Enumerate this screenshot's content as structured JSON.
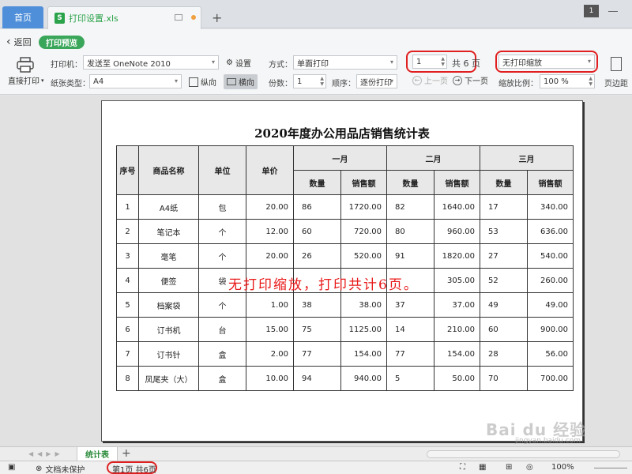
{
  "tabs": {
    "home": "首页",
    "file_name": "打印设置.xls",
    "file_icon_letter": "S",
    "add": "+",
    "window_count": "1"
  },
  "toolbar": {
    "back": "返回",
    "preview_badge": "打印预览",
    "direct_print": "直接打印",
    "printer_label": "打印机：",
    "printer_value": "发送至 OneNote 2010",
    "settings": "设置",
    "paper_label": "纸张类型：",
    "paper_value": "A4",
    "portrait": "纵向",
    "landscape": "横向",
    "mode_label": "方式：",
    "mode_value": "单面打印",
    "copies_label": "份数：",
    "copies_value": "1",
    "order_label": "顺序：",
    "order_value": "逐份打印",
    "page_current": "1",
    "page_total": "共 6 页",
    "prev_page": "上一页",
    "next_page": "下一页",
    "scale_value": "无打印缩放",
    "zoom_label": "缩放比例：",
    "zoom_value": "100 %",
    "page_margin": "页边距"
  },
  "document": {
    "title": "2020年度办公用品店销售统计表",
    "headers": {
      "seq": "序号",
      "product": "商品名称",
      "unit": "单位",
      "price": "单价",
      "jan": "一月",
      "feb": "二月",
      "mar": "三月",
      "qty": "数量",
      "sales": "销售额"
    },
    "rows": [
      {
        "seq": "1",
        "product": "A4纸",
        "unit": "包",
        "price": "20.00",
        "jan_qty": "86",
        "jan_sales": "1720.00",
        "feb_qty": "82",
        "feb_sales": "1640.00",
        "mar_qty": "17",
        "mar_sales": "340.00"
      },
      {
        "seq": "2",
        "product": "笔记本",
        "unit": "个",
        "price": "12.00",
        "jan_qty": "60",
        "jan_sales": "720.00",
        "feb_qty": "80",
        "feb_sales": "960.00",
        "mar_qty": "53",
        "mar_sales": "636.00"
      },
      {
        "seq": "3",
        "product": "毫笔",
        "unit": "个",
        "price": "20.00",
        "jan_qty": "26",
        "jan_sales": "520.00",
        "feb_qty": "91",
        "feb_sales": "1820.00",
        "mar_qty": "27",
        "mar_sales": "540.00"
      },
      {
        "seq": "4",
        "product": "便签",
        "unit": "袋",
        "price": "",
        "jan_qty": "",
        "jan_sales": "",
        "feb_qty": "",
        "feb_sales": "305.00",
        "mar_qty": "52",
        "mar_sales": "260.00"
      },
      {
        "seq": "5",
        "product": "档案袋",
        "unit": "个",
        "price": "1.00",
        "jan_qty": "38",
        "jan_sales": "38.00",
        "feb_qty": "37",
        "feb_sales": "37.00",
        "mar_qty": "49",
        "mar_sales": "49.00"
      },
      {
        "seq": "6",
        "product": "订书机",
        "unit": "台",
        "price": "15.00",
        "jan_qty": "75",
        "jan_sales": "1125.00",
        "feb_qty": "14",
        "feb_sales": "210.00",
        "mar_qty": "60",
        "mar_sales": "900.00"
      },
      {
        "seq": "7",
        "product": "订书针",
        "unit": "盒",
        "price": "2.00",
        "jan_qty": "77",
        "jan_sales": "154.00",
        "feb_qty": "77",
        "feb_sales": "154.00",
        "mar_qty": "28",
        "mar_sales": "56.00"
      },
      {
        "seq": "8",
        "product": "凤尾夹（大）",
        "unit": "盒",
        "price": "10.00",
        "jan_qty": "94",
        "jan_sales": "940.00",
        "feb_qty": "5",
        "feb_sales": "50.00",
        "mar_qty": "70",
        "mar_sales": "700.00"
      }
    ],
    "annotation": "无打印缩放，打印共计6页。"
  },
  "sheetbar": {
    "tab": "统计表",
    "add": "+"
  },
  "statusbar": {
    "protect": "文档未保护",
    "page_info": "第1页 共6页",
    "zoom": "100%"
  },
  "watermark": {
    "logo": "Bai du 经验",
    "sub": "jingyan.baidu.com"
  },
  "colors": {
    "accent_green": "#3aa65a",
    "home_tab_blue": "#4f8fd9",
    "annotation_red": "#e81818"
  }
}
